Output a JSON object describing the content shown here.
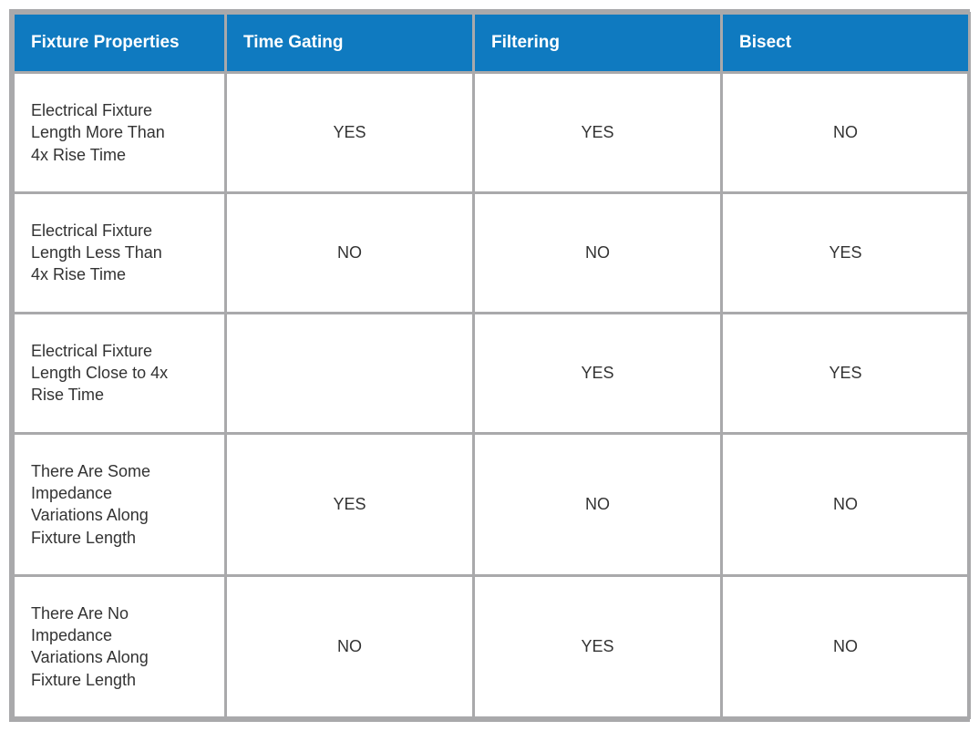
{
  "headers": {
    "col0": "Fixture Properties",
    "col1": "Time Gating",
    "col2": "Filtering",
    "col3": "Bisect"
  },
  "rows": [
    {
      "property": "Electrical Fixture Length More Than 4x Rise Time",
      "time_gating": "YES",
      "filtering": "YES",
      "bisect": "NO"
    },
    {
      "property": "Electrical Fixture Length Less Than 4x Rise Time",
      "time_gating": "NO",
      "filtering": "NO",
      "bisect": "YES"
    },
    {
      "property": "Electrical Fixture Length Close to 4x Rise Time",
      "time_gating": "",
      "filtering": "YES",
      "bisect": "YES"
    },
    {
      "property": "There Are Some Impedance Variations Along Fixture Length",
      "time_gating": "YES",
      "filtering": "NO",
      "bisect": "NO"
    },
    {
      "property": "There Are No Impedance Variations Along Fixture Length",
      "time_gating": "NO",
      "filtering": "YES",
      "bisect": "NO"
    }
  ]
}
